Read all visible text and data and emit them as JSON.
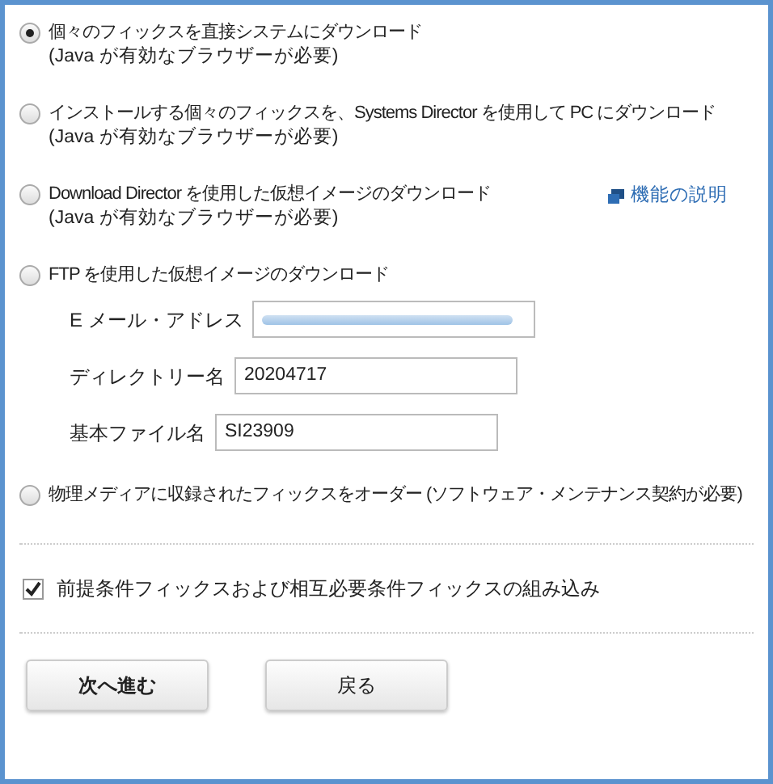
{
  "options": [
    {
      "label": "個々のフィックスを直接システムにダウンロード",
      "note": "(Java が有効なブラウザーが必要)",
      "selected": true
    },
    {
      "label": "インストールする個々のフィックスを、Systems Director を使用して PC にダウンロード",
      "note": "(Java が有効なブラウザーが必要)",
      "selected": false
    },
    {
      "label": "Download Director を使用した仮想イメージのダウンロード",
      "note": "(Java が有効なブラウザーが必要)",
      "selected": false,
      "link": "機能の説明"
    },
    {
      "label": "FTP を使用した仮想イメージのダウンロード",
      "selected": false,
      "fields": [
        {
          "label": "E メール・アドレス",
          "redacted": true
        },
        {
          "label": "ディレクトリー名",
          "value": "20204717"
        },
        {
          "label": "基本ファイル名",
          "value": "SI23909"
        }
      ]
    },
    {
      "label": "物理メディアに収録されたフィックスをオーダー (ソフトウェア・メンテナンス契約が必要)",
      "selected": false
    }
  ],
  "include_prereqs": {
    "label": "前提条件フィックスおよび相互必要条件フィックスの組み込み",
    "checked": true
  },
  "buttons": [
    {
      "label": "次へ進む",
      "kind": "primary"
    },
    {
      "label": "戻る",
      "kind": "secondary"
    }
  ]
}
